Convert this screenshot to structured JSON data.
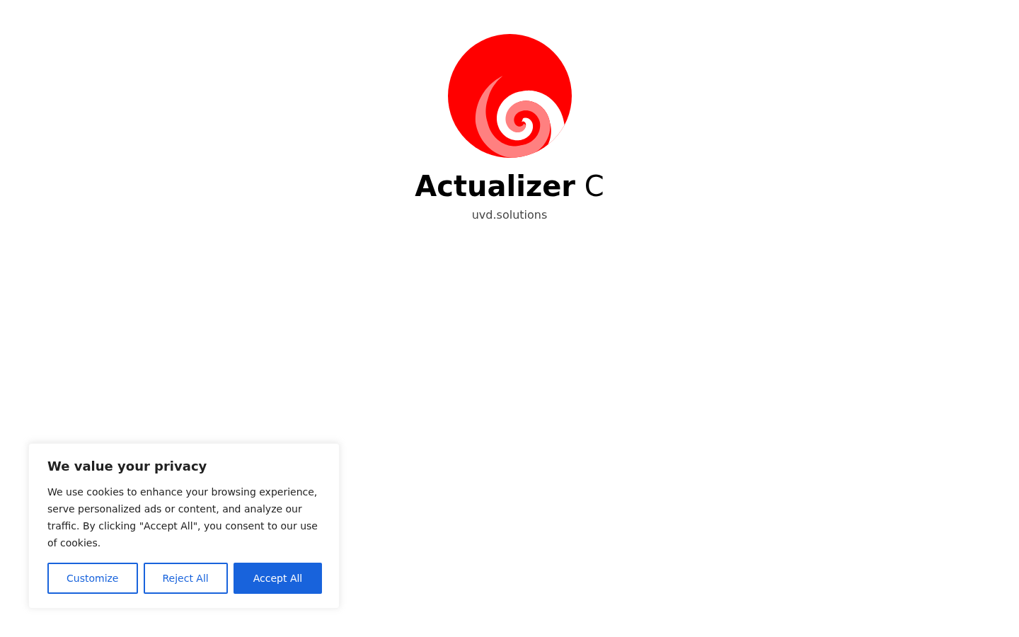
{
  "brand": {
    "title": "**Actualizer** C",
    "subtitle": "uvd.solutions"
  },
  "cookie_banner": {
    "title": "We value your privacy",
    "message": "We use cookies to enhance your browsing experience, serve personalized ads or content, and analyze our traffic. By clicking \"Accept All\", you consent to our use of cookies.",
    "buttons": [
      {
        "label": "Customize",
        "kind": "outline"
      },
      {
        "label": "Reject All",
        "kind": "outline"
      },
      {
        "label": "Accept All",
        "kind": "filled"
      }
    ]
  }
}
